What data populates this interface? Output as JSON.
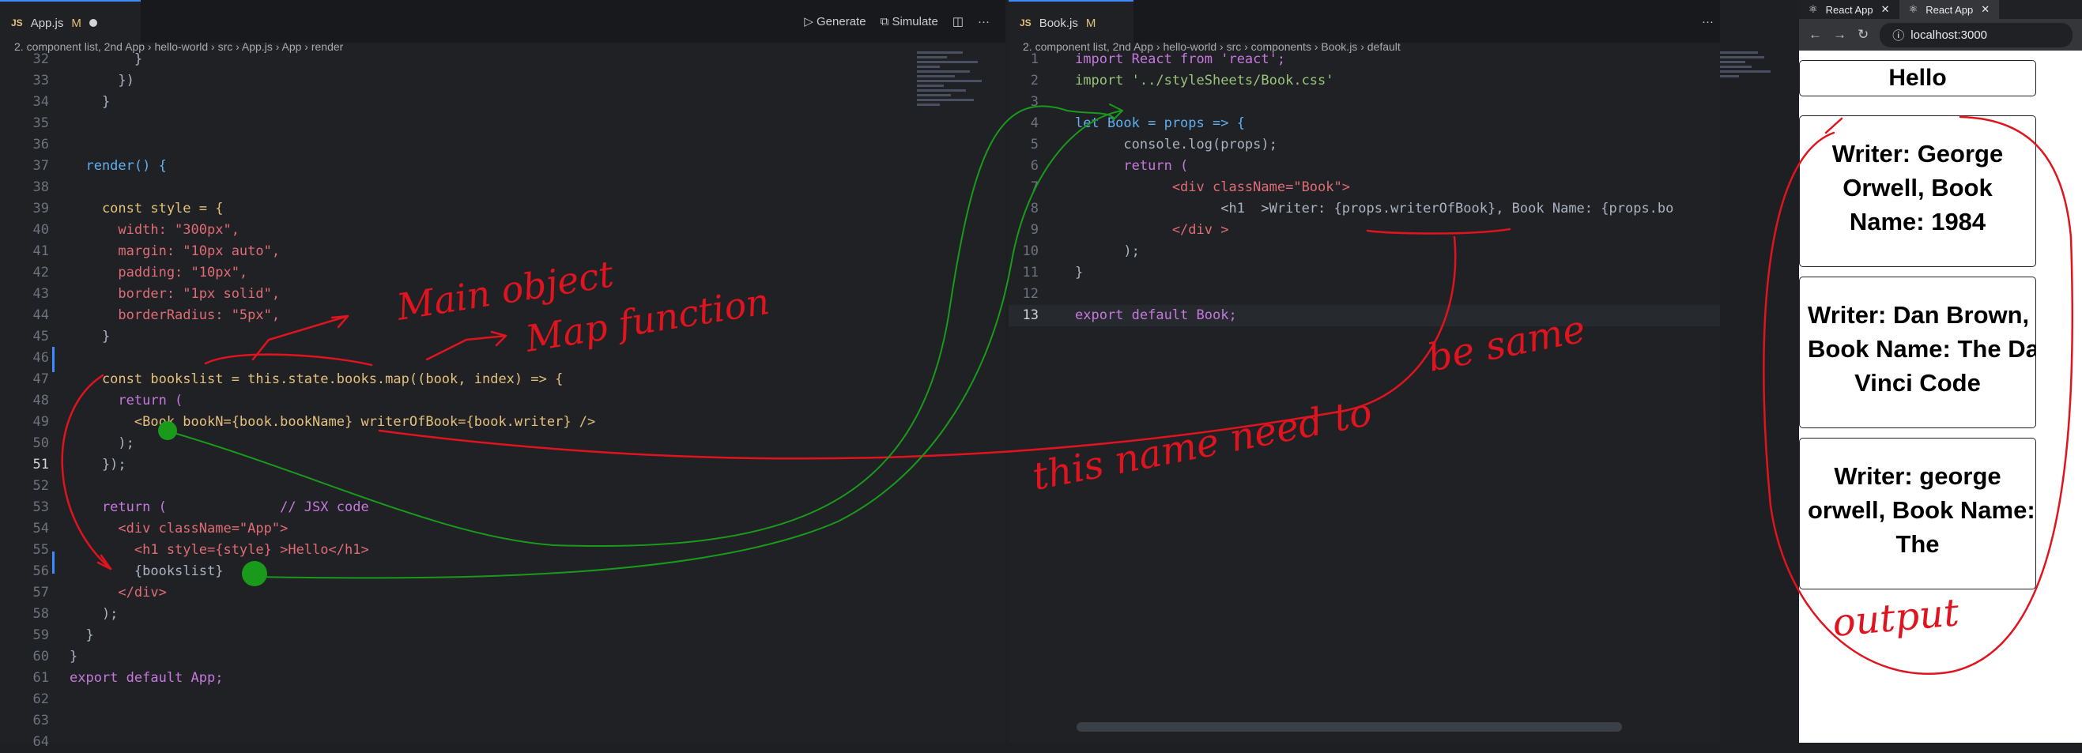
{
  "left_editor": {
    "tab_label": "App.js",
    "tab_ext": "JS",
    "tab_mod": "M",
    "toolbar": {
      "generate": "Generate",
      "simulate": "Simulate",
      "more": "···"
    },
    "breadcrumb": "2. component list, 2nd App  ›  hello-world  ›  src  ›  App.js  ›  App  ›  render",
    "lines": [
      {
        "n": "32",
        "t": "        }"
      },
      {
        "n": "33",
        "t": "      })"
      },
      {
        "n": "34",
        "t": "    }"
      },
      {
        "n": "35",
        "t": ""
      },
      {
        "n": "36",
        "t": ""
      },
      {
        "n": "37",
        "t": "  render() {"
      },
      {
        "n": "38",
        "t": ""
      },
      {
        "n": "39",
        "t": "    const style = {"
      },
      {
        "n": "40",
        "t": "      width: \"300px\","
      },
      {
        "n": "41",
        "t": "      margin: \"10px auto\","
      },
      {
        "n": "42",
        "t": "      padding: \"10px\","
      },
      {
        "n": "43",
        "t": "      border: \"1px solid\","
      },
      {
        "n": "44",
        "t": "      borderRadius: \"5px\","
      },
      {
        "n": "45",
        "t": "    }"
      },
      {
        "n": "46",
        "t": ""
      },
      {
        "n": "47",
        "t": "    const bookslist = this.state.books.map((book, index) => {"
      },
      {
        "n": "48",
        "t": "      return ("
      },
      {
        "n": "49",
        "t": "        <Book bookN={book.bookName} writerOfBook={book.writer} />"
      },
      {
        "n": "50",
        "t": "      );"
      },
      {
        "n": "51",
        "t": "    });"
      },
      {
        "n": "52",
        "t": ""
      },
      {
        "n": "53",
        "t": "    return (              // JSX code"
      },
      {
        "n": "54",
        "t": "      <div className=\"App\">"
      },
      {
        "n": "55",
        "t": "        <h1 style={style} >Hello</h1>"
      },
      {
        "n": "56",
        "t": "        {bookslist}"
      },
      {
        "n": "57",
        "t": "      </div>"
      },
      {
        "n": "58",
        "t": "    );"
      },
      {
        "n": "59",
        "t": "  }"
      },
      {
        "n": "60",
        "t": "}"
      },
      {
        "n": "61",
        "t": "export default App;"
      },
      {
        "n": "62",
        "t": ""
      },
      {
        "n": "63",
        "t": ""
      },
      {
        "n": "64",
        "t": ""
      }
    ]
  },
  "right_editor": {
    "tab_label": "Book.js",
    "tab_ext": "JS",
    "tab_mod": "M",
    "more": "···",
    "breadcrumb": "2. component list, 2nd App  ›  hello-world  ›  src  ›  components  ›  Book.js  ›  default",
    "lines": [
      {
        "n": "1",
        "t": "import React from 'react';"
      },
      {
        "n": "2",
        "t": "import '../styleSheets/Book.css'"
      },
      {
        "n": "3",
        "t": ""
      },
      {
        "n": "4",
        "t": "let Book = props => {"
      },
      {
        "n": "5",
        "t": "      console.log(props);"
      },
      {
        "n": "6",
        "t": "      return ("
      },
      {
        "n": "7",
        "t": "            <div className=\"Book\">"
      },
      {
        "n": "8",
        "t": "                  <h1  >Writer: {props.writerOfBook}, Book Name: {props.bo"
      },
      {
        "n": "9",
        "t": "            </div >"
      },
      {
        "n": "10",
        "t": "      );"
      },
      {
        "n": "11",
        "t": "}"
      },
      {
        "n": "12",
        "t": ""
      },
      {
        "n": "13",
        "t": "export default Book;"
      }
    ]
  },
  "browser": {
    "tabs": [
      "React App",
      "React App"
    ],
    "url": "localhost:3000",
    "hello": "Hello",
    "books": [
      [
        "Writer: George",
        "Orwell, Book",
        "Name: 1984"
      ],
      [
        "Writer: Dan Brown,",
        "Book Name: The Da",
        "Vinci Code"
      ],
      [
        "Writer: george",
        "orwell, Book Name:",
        "The"
      ]
    ]
  },
  "annotations": {
    "main_object": "Main object",
    "map_function": "Map function",
    "be_same": "be same",
    "this_name": "this name need to",
    "output": "output"
  },
  "colors": {
    "annotation_red": "#e0141e",
    "annotation_green": "#1a9a1a",
    "accent": "#3d8bfd"
  }
}
